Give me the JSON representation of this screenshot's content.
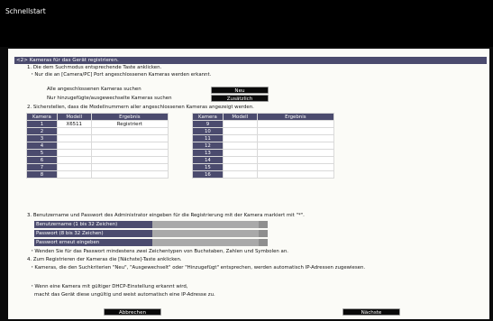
{
  "window": {
    "title": "Schnellstart"
  },
  "section": {
    "header": "<2> Kameras für das Gerät registrieren."
  },
  "step1": {
    "title": "1. Die dem Suchmodus entsprechende Taste anklicken.",
    "note": "・Nur die an [Camera/PC] Port angeschlossenen Kameras werden erkannt.",
    "search_all_label": "Alle angeschlossenen Kameras suchen",
    "search_all_button": "Neu",
    "search_new_label": "Nur hinzugefügte/ausgewechselte Kameras suchen",
    "search_new_button": "Zusätzlich"
  },
  "step2": {
    "title": "2. Sicherstellen, dass die Modellnummern aller angeschlossenen Kameras angezeigt werden.",
    "columns": [
      "Kamera",
      "Modell",
      "Ergebnis"
    ],
    "left_rows": [
      [
        "1",
        "X6511",
        "Registriert"
      ],
      [
        "2",
        "",
        ""
      ],
      [
        "3",
        "",
        ""
      ],
      [
        "4",
        "",
        ""
      ],
      [
        "5",
        "",
        ""
      ],
      [
        "6",
        "",
        ""
      ],
      [
        "7",
        "",
        ""
      ],
      [
        "8",
        "",
        ""
      ]
    ],
    "right_rows": [
      [
        "9",
        "",
        ""
      ],
      [
        "10",
        "",
        ""
      ],
      [
        "11",
        "",
        ""
      ],
      [
        "12",
        "",
        ""
      ],
      [
        "13",
        "",
        ""
      ],
      [
        "14",
        "",
        ""
      ],
      [
        "15",
        "",
        ""
      ],
      [
        "16",
        "",
        ""
      ]
    ]
  },
  "step3": {
    "title": "3. Benutzername und Passwort des Administrator eingeben für die Registrierung mit der Kamera markiert mit \"*\".",
    "username_label": "Benutzername (1 bis 32 Zeichen)",
    "username_value": "",
    "password_label": "Passwort (8 bis 32 Zeichen)",
    "password_value": "",
    "password_repeat_label": "Passwort erneut eingeben",
    "password_repeat_value": "",
    "note": "・Wenden Sie für das Passwort mindestens zwei Zeichentypen von Buchstaben, Zahlen und Symbolen an."
  },
  "step4": {
    "title": "4. Zum Registrieren der Kameras die [Nächste]-Taste anklicken.",
    "note1": "・Kameras, die den Suchkriterien \"Neu\", \"Ausgewechselt\" oder \"Hinzugefügt\" entsprechen, werden automatisch IP-Adressen zugewiesen.",
    "note2a": "・Wenn eine Kamera mit gültiger DHCP-Einstellung erkannt wird,",
    "note2b": "macht das Gerät diese ungültig und weist automatisch eine IP-Adresse zu."
  },
  "footer": {
    "cancel_button": "Abbrechen",
    "next_button": "Nächste"
  }
}
